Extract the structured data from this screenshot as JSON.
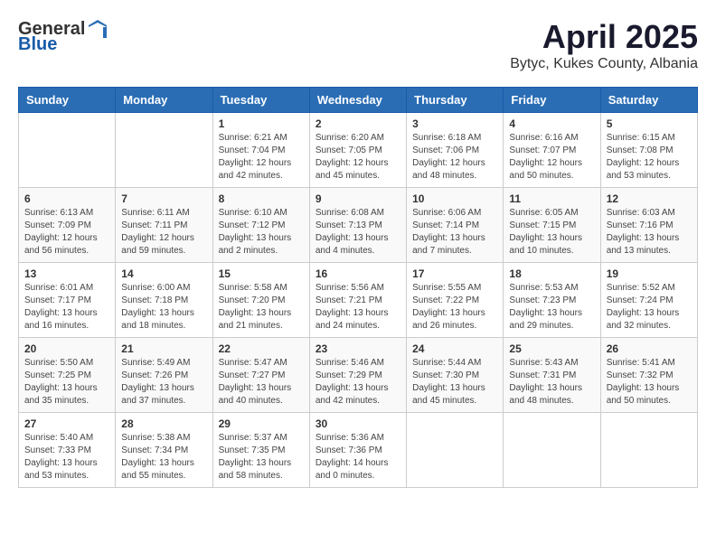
{
  "header": {
    "logo_general": "General",
    "logo_blue": "Blue",
    "month": "April 2025",
    "location": "Bytyc, Kukes County, Albania"
  },
  "weekdays": [
    "Sunday",
    "Monday",
    "Tuesday",
    "Wednesday",
    "Thursday",
    "Friday",
    "Saturday"
  ],
  "weeks": [
    [
      {
        "day": "",
        "info": ""
      },
      {
        "day": "",
        "info": ""
      },
      {
        "day": "1",
        "info": "Sunrise: 6:21 AM\nSunset: 7:04 PM\nDaylight: 12 hours and 42 minutes."
      },
      {
        "day": "2",
        "info": "Sunrise: 6:20 AM\nSunset: 7:05 PM\nDaylight: 12 hours and 45 minutes."
      },
      {
        "day": "3",
        "info": "Sunrise: 6:18 AM\nSunset: 7:06 PM\nDaylight: 12 hours and 48 minutes."
      },
      {
        "day": "4",
        "info": "Sunrise: 6:16 AM\nSunset: 7:07 PM\nDaylight: 12 hours and 50 minutes."
      },
      {
        "day": "5",
        "info": "Sunrise: 6:15 AM\nSunset: 7:08 PM\nDaylight: 12 hours and 53 minutes."
      }
    ],
    [
      {
        "day": "6",
        "info": "Sunrise: 6:13 AM\nSunset: 7:09 PM\nDaylight: 12 hours and 56 minutes."
      },
      {
        "day": "7",
        "info": "Sunrise: 6:11 AM\nSunset: 7:11 PM\nDaylight: 12 hours and 59 minutes."
      },
      {
        "day": "8",
        "info": "Sunrise: 6:10 AM\nSunset: 7:12 PM\nDaylight: 13 hours and 2 minutes."
      },
      {
        "day": "9",
        "info": "Sunrise: 6:08 AM\nSunset: 7:13 PM\nDaylight: 13 hours and 4 minutes."
      },
      {
        "day": "10",
        "info": "Sunrise: 6:06 AM\nSunset: 7:14 PM\nDaylight: 13 hours and 7 minutes."
      },
      {
        "day": "11",
        "info": "Sunrise: 6:05 AM\nSunset: 7:15 PM\nDaylight: 13 hours and 10 minutes."
      },
      {
        "day": "12",
        "info": "Sunrise: 6:03 AM\nSunset: 7:16 PM\nDaylight: 13 hours and 13 minutes."
      }
    ],
    [
      {
        "day": "13",
        "info": "Sunrise: 6:01 AM\nSunset: 7:17 PM\nDaylight: 13 hours and 16 minutes."
      },
      {
        "day": "14",
        "info": "Sunrise: 6:00 AM\nSunset: 7:18 PM\nDaylight: 13 hours and 18 minutes."
      },
      {
        "day": "15",
        "info": "Sunrise: 5:58 AM\nSunset: 7:20 PM\nDaylight: 13 hours and 21 minutes."
      },
      {
        "day": "16",
        "info": "Sunrise: 5:56 AM\nSunset: 7:21 PM\nDaylight: 13 hours and 24 minutes."
      },
      {
        "day": "17",
        "info": "Sunrise: 5:55 AM\nSunset: 7:22 PM\nDaylight: 13 hours and 26 minutes."
      },
      {
        "day": "18",
        "info": "Sunrise: 5:53 AM\nSunset: 7:23 PM\nDaylight: 13 hours and 29 minutes."
      },
      {
        "day": "19",
        "info": "Sunrise: 5:52 AM\nSunset: 7:24 PM\nDaylight: 13 hours and 32 minutes."
      }
    ],
    [
      {
        "day": "20",
        "info": "Sunrise: 5:50 AM\nSunset: 7:25 PM\nDaylight: 13 hours and 35 minutes."
      },
      {
        "day": "21",
        "info": "Sunrise: 5:49 AM\nSunset: 7:26 PM\nDaylight: 13 hours and 37 minutes."
      },
      {
        "day": "22",
        "info": "Sunrise: 5:47 AM\nSunset: 7:27 PM\nDaylight: 13 hours and 40 minutes."
      },
      {
        "day": "23",
        "info": "Sunrise: 5:46 AM\nSunset: 7:29 PM\nDaylight: 13 hours and 42 minutes."
      },
      {
        "day": "24",
        "info": "Sunrise: 5:44 AM\nSunset: 7:30 PM\nDaylight: 13 hours and 45 minutes."
      },
      {
        "day": "25",
        "info": "Sunrise: 5:43 AM\nSunset: 7:31 PM\nDaylight: 13 hours and 48 minutes."
      },
      {
        "day": "26",
        "info": "Sunrise: 5:41 AM\nSunset: 7:32 PM\nDaylight: 13 hours and 50 minutes."
      }
    ],
    [
      {
        "day": "27",
        "info": "Sunrise: 5:40 AM\nSunset: 7:33 PM\nDaylight: 13 hours and 53 minutes."
      },
      {
        "day": "28",
        "info": "Sunrise: 5:38 AM\nSunset: 7:34 PM\nDaylight: 13 hours and 55 minutes."
      },
      {
        "day": "29",
        "info": "Sunrise: 5:37 AM\nSunset: 7:35 PM\nDaylight: 13 hours and 58 minutes."
      },
      {
        "day": "30",
        "info": "Sunrise: 5:36 AM\nSunset: 7:36 PM\nDaylight: 14 hours and 0 minutes."
      },
      {
        "day": "",
        "info": ""
      },
      {
        "day": "",
        "info": ""
      },
      {
        "day": "",
        "info": ""
      }
    ]
  ]
}
